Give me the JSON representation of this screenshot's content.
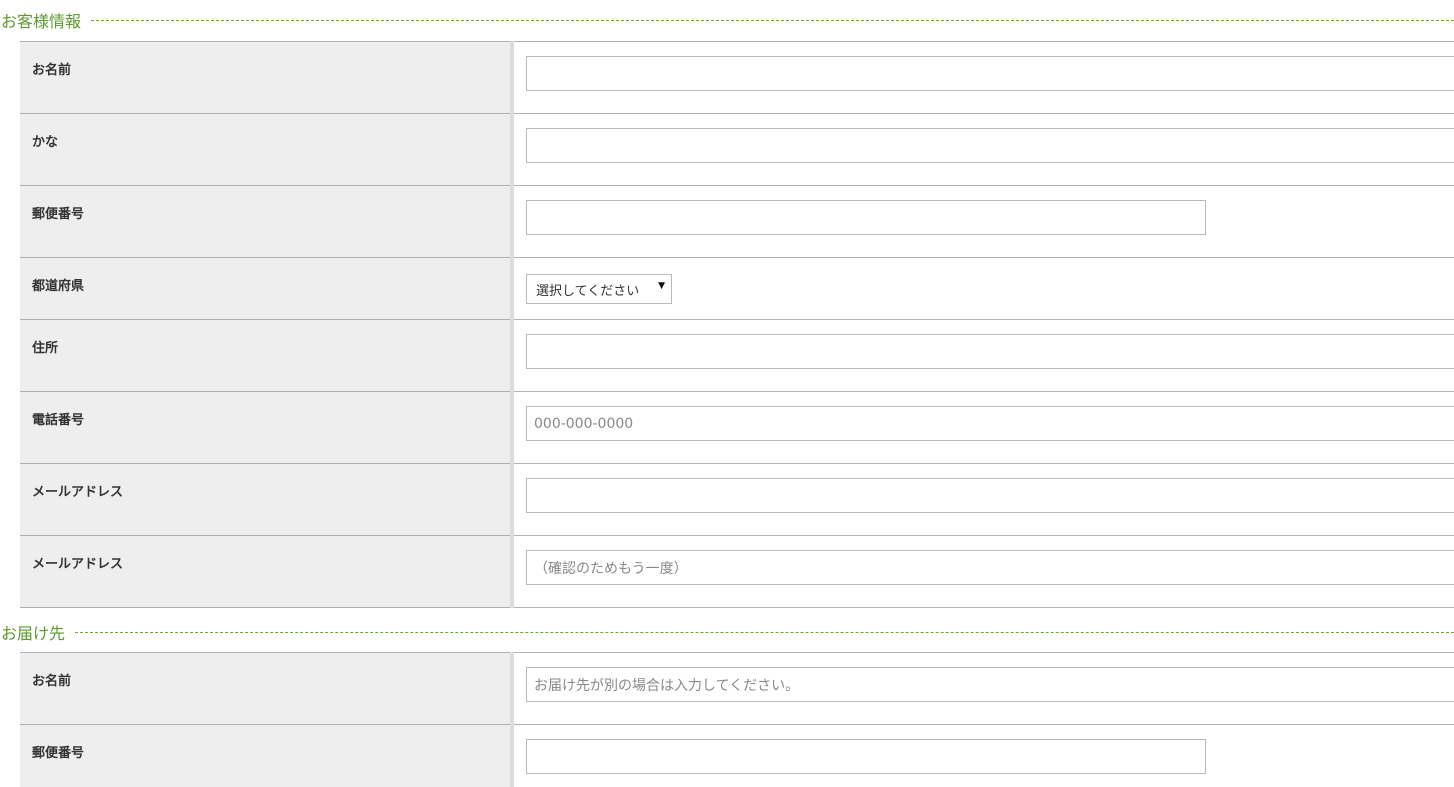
{
  "customer_section": {
    "title": "お客様情報",
    "fields": {
      "name": {
        "label": "お名前",
        "value": ""
      },
      "kana": {
        "label": "かな",
        "value": ""
      },
      "zip": {
        "label": "郵便番号",
        "value": ""
      },
      "prefecture": {
        "label": "都道府県",
        "selected": "選択してください"
      },
      "address": {
        "label": "住所",
        "value": ""
      },
      "phone": {
        "label": "電話番号",
        "placeholder": "000-000-0000"
      },
      "email": {
        "label": "メールアドレス",
        "value": ""
      },
      "email_confirm": {
        "label": "メールアドレス",
        "placeholder": "（確認のためもう一度）"
      }
    }
  },
  "delivery_section": {
    "title": "お届け先",
    "fields": {
      "name": {
        "label": "お名前",
        "placeholder": "お届け先が別の場合は入力してください。"
      },
      "zip": {
        "label": "郵便番号",
        "value": ""
      }
    }
  },
  "icons": {
    "select_arrow": "triangle-down-icon"
  },
  "colors": {
    "heading": "#5c9a2e",
    "label_bg": "#eeeeee",
    "border": "#b0b0b0"
  }
}
